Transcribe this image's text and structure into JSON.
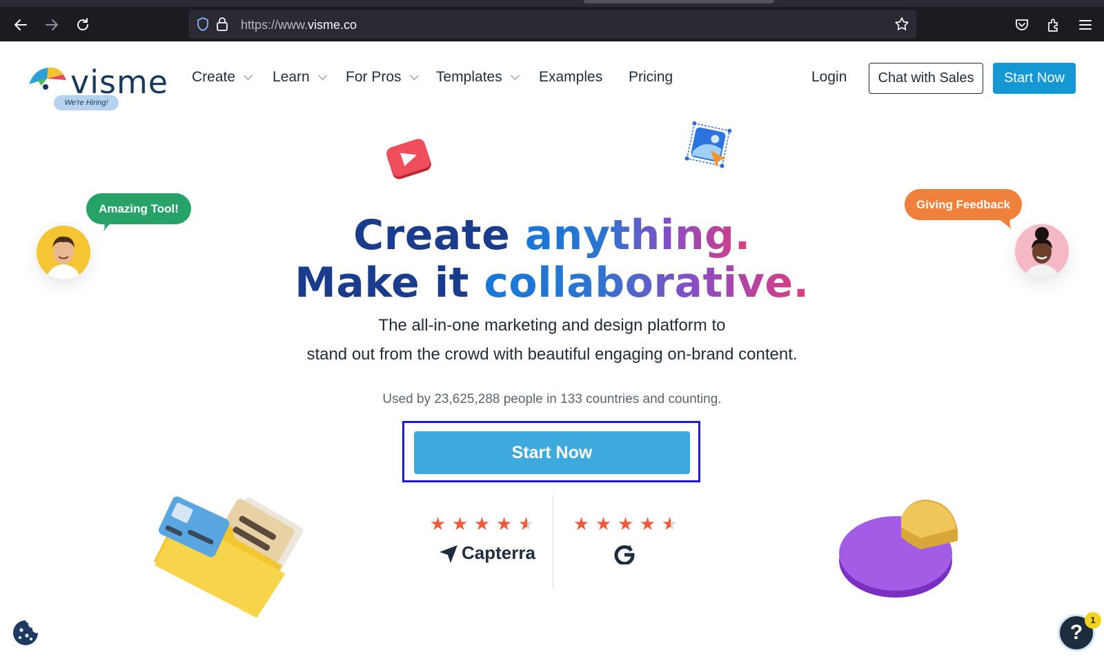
{
  "browser": {
    "url_prefix": "https://www.",
    "url_domain": "visme.co",
    "icons": [
      "back-icon",
      "forward-icon",
      "reload-icon",
      "shield-icon",
      "lock-icon",
      "bookmark-star-icon",
      "pocket-icon",
      "extensions-icon",
      "menu-icon"
    ]
  },
  "brand": {
    "logo_text": "visme",
    "hiring_badge": "We're Hiring!"
  },
  "nav": {
    "items": [
      {
        "label": "Create",
        "has_dropdown": true
      },
      {
        "label": "Learn",
        "has_dropdown": true
      },
      {
        "label": "For Pros",
        "has_dropdown": true
      },
      {
        "label": "Templates",
        "has_dropdown": true
      },
      {
        "label": "Examples",
        "has_dropdown": false
      },
      {
        "label": "Pricing",
        "has_dropdown": false
      }
    ],
    "login": "Login",
    "chat_with_sales": "Chat with Sales",
    "start_now": "Start Now"
  },
  "hero": {
    "line1_a": "Create",
    "line1_b": "anything.",
    "line2_a": "Make it",
    "line2_b": "collaborative.",
    "sub1": "The all-in-one marketing and design platform to",
    "sub2": "stand out from the crowd with beautiful engaging on-brand content.",
    "usage": "Used by 23,625,288 people in 133 countries and counting.",
    "cta": "Start Now"
  },
  "bubbles": {
    "left": "Amazing Tool!",
    "right": "Giving Feedback"
  },
  "ratings": [
    {
      "source": "Capterra",
      "stars": 4.5
    },
    {
      "source": "G2",
      "stars": 4.5
    }
  ],
  "help": {
    "label": "?",
    "badge": "1"
  },
  "colors": {
    "brand_navy": "#1a3c8c",
    "cta_blue": "#3ea9dc",
    "top_cta": "#1597d3",
    "highlight": "#1a1ad8",
    "star": "#ef5a3c"
  }
}
